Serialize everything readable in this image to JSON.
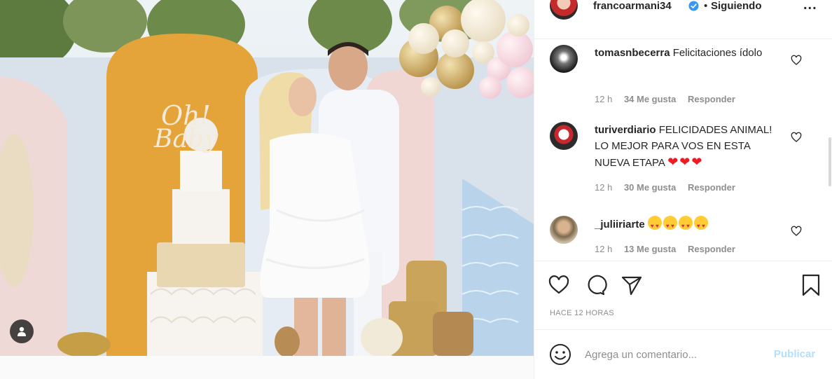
{
  "post": {
    "username": "francoarmani34",
    "separator": "•",
    "follow_status": "Siguiendo",
    "more_label": "...",
    "timestamp": "HACE 12 HORAS"
  },
  "comments": [
    {
      "username": "tomasnbecerra",
      "text": "Felicitaciones ídolo",
      "age": "12 h",
      "likes": "34 Me gusta",
      "reply": "Responder"
    },
    {
      "username": "turiverdiario",
      "text": "FELICIDADES ANIMAL! LO MEJOR PARA VOS EN ESTA NUEVA ETAPA",
      "hearts": "❤❤❤",
      "age": "12 h",
      "likes": "30 Me gusta",
      "reply": "Responder"
    },
    {
      "username": "_juliiriarte",
      "age": "12 h",
      "likes": "13 Me gusta",
      "reply": "Responder"
    }
  ],
  "add_comment": {
    "placeholder": "Agrega un comentario...",
    "publish_label": "Publicar"
  },
  "colors": {
    "verified": "#3897f0",
    "publish_disabled": "#b2dffc",
    "secondary_text": "#8e8e8e"
  },
  "icons": [
    "verified-badge-icon",
    "like-heart-icon",
    "comment-icon",
    "share-icon",
    "save-bookmark-icon",
    "emoji-icon",
    "user-tag-icon"
  ]
}
